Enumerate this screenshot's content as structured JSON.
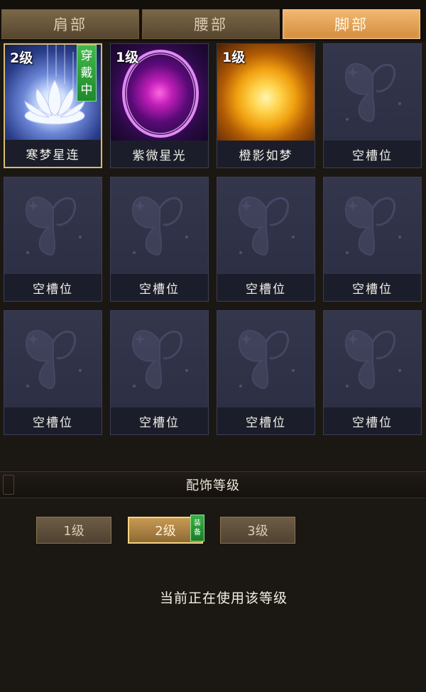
{
  "tabs": [
    {
      "label": "肩部",
      "active": false
    },
    {
      "label": "腰部",
      "active": false
    },
    {
      "label": "脚部",
      "active": true
    }
  ],
  "slots": [
    {
      "name": "寒梦星连",
      "level": "2级",
      "state": "穿戴中",
      "art": "lotus-icon"
    },
    {
      "name": "紫微星光",
      "level": "1级",
      "art": "purple-orb-icon"
    },
    {
      "name": "橙影如梦",
      "level": "1级",
      "art": "sun-orb-icon"
    },
    {
      "name": "空槽位"
    },
    {
      "name": "空槽位"
    },
    {
      "name": "空槽位"
    },
    {
      "name": "空槽位"
    },
    {
      "name": "空槽位"
    },
    {
      "name": "空槽位"
    },
    {
      "name": "空槽位"
    },
    {
      "name": "空槽位"
    },
    {
      "name": "空槽位"
    }
  ],
  "wear_tag": {
    "line1": "穿",
    "line2": "戴",
    "line3": "中"
  },
  "level_section": {
    "title": "配饰等级",
    "buttons": [
      "1级",
      "2级",
      "3级"
    ],
    "active_index": 1,
    "equip_tag": {
      "line1": "装",
      "line2": "备"
    },
    "status": "当前正在使用该等级"
  },
  "colors": {
    "active_tab": "#e0a050",
    "wear_tag": "#2fa33b",
    "slot_bg": "#2f3146"
  }
}
